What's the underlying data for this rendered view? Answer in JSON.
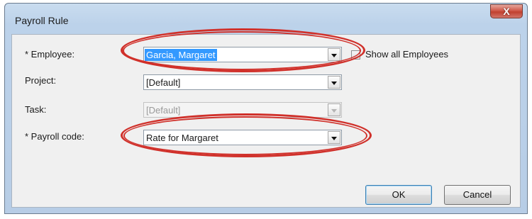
{
  "window": {
    "title": "Payroll Rule",
    "close_glyph": "X"
  },
  "form": {
    "employee": {
      "label": "* Employee:",
      "value": "Garcia, Margaret"
    },
    "show_all": {
      "label": "Show all Employees",
      "checked": false
    },
    "project": {
      "label": "Project:",
      "value": "[Default]"
    },
    "task": {
      "label": "Task:",
      "value": "[Default]",
      "disabled": true
    },
    "payroll_code": {
      "label": "* Payroll code:",
      "value": "Rate for Margaret"
    }
  },
  "buttons": {
    "ok_label": "OK",
    "cancel_label": "Cancel"
  },
  "colors": {
    "annotation": "#d0302a",
    "selection": "#3399ff"
  }
}
